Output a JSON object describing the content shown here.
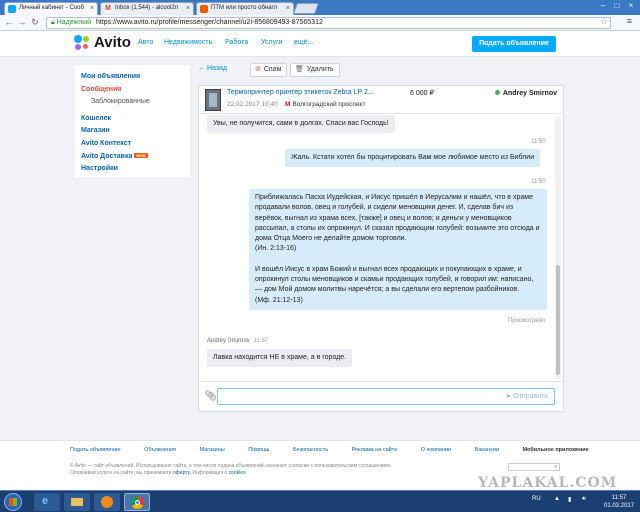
{
  "browser": {
    "tabs": [
      {
        "label": "Личный кабинет - Сооб",
        "favicon_color": "#00aaff",
        "active": true
      },
      {
        "label": "Inbox (1,544) - alcool2n",
        "favicon_color": "#d93025",
        "icon": "gmail-icon"
      },
      {
        "label": "ПТМ или просто обнагл",
        "favicon_color": "#e66000"
      }
    ],
    "security_label": "Надежный",
    "url": "https://www.avito.ru/profile/messenger/channel/u2i-856809493-87565312"
  },
  "site": {
    "logo": "Avito",
    "nav": [
      "Авто",
      "Недвижимость",
      "Работа",
      "Услуги",
      "ещё..."
    ],
    "post_ad": "Подать объявление"
  },
  "sidebar": {
    "items": [
      {
        "label": "Мои объявления"
      },
      {
        "label": "Сообщения",
        "active": true
      },
      {
        "label": "Заблокированные",
        "sub": true
      },
      {
        "label": "Кошелек"
      },
      {
        "label": "Магазин"
      },
      {
        "label": "Avito Контекст"
      },
      {
        "label": "Avito Доставка",
        "badge": "NEW"
      },
      {
        "label": "Настройки"
      }
    ]
  },
  "toolbar": {
    "back": "← Назад",
    "spam": "Спам",
    "delete": "Удалить"
  },
  "chat": {
    "item_title": "Термопринтер принтер этикеток Zebra LP 2...",
    "price": "6 000 ₽",
    "date": "22.02.2017 10:40",
    "metro": "Волгоградский проспект",
    "seller": "Andrey Smirnov",
    "messages": [
      {
        "dir": "in",
        "text": "Увы, не получится, сами в долгах. Спаси вас Господь!"
      },
      {
        "dir": "out",
        "time": "11:50",
        "text": "Жаль. Кстати хотел бы процитировать Вам мое любимое место из Библии"
      },
      {
        "dir": "out",
        "time": "11:50",
        "lines": [
          "Приближалась Пасха Иудейская, и Иисус пришёл в Иерусалим и нашёл, что в храме",
          "продавали волов, овец и голубей, и сидели меновщики денег. И, сделав бич из",
          "верёвок, выгнал из храма всех, [также] и овец и волов; и деньги у меновщиков",
          "рассыпал, а столы их опрокинул. И сказал продающим голубей: возьмите это отсюда и",
          "дома Отца Моего не делайте домом торговли.",
          "(Ин. 2:13-16)",
          "",
          "И вошёл Иисус в храм Божий и выгнал всех продающих и покупающих в храме, и",
          "опрокинул столы меновщиков и скамьи продающих голубей, и говорил им: написано,",
          "— дом Мой домом молитвы наречётся; а вы сделали его вертепом разбойников.",
          "(Мф. 21:12-13)"
        ],
        "status": "Просмотрено"
      },
      {
        "dir": "in",
        "author": "Andrey Smirnov",
        "time": "11:57",
        "text": "Лавка находится НЕ в храме, а в городе."
      }
    ],
    "send": "Отправить"
  },
  "footer": {
    "links": [
      "Подать объявление",
      "Объявления",
      "Магазины",
      "Помощь",
      "Безопасность",
      "Реклама на сайте",
      "О компании",
      "Вакансии",
      "Мобильное приложение"
    ],
    "legal_1": "© Avito — сайт объявлений. Использование сайта, в том числе подача объявлений, означает согласие с пользовательским соглашением.",
    "legal_2_pre": "Оплачивая услуги на сайте, вы принимаете",
    "legal_2_link": "оферту",
    "legal_2_mid": ". Информация о",
    "legal_2_link2": "cookies",
    "watermark": "YAPLAKAL.COM"
  },
  "taskbar": {
    "lang": "RU",
    "time": "11:57",
    "date": "01.03.2017"
  }
}
